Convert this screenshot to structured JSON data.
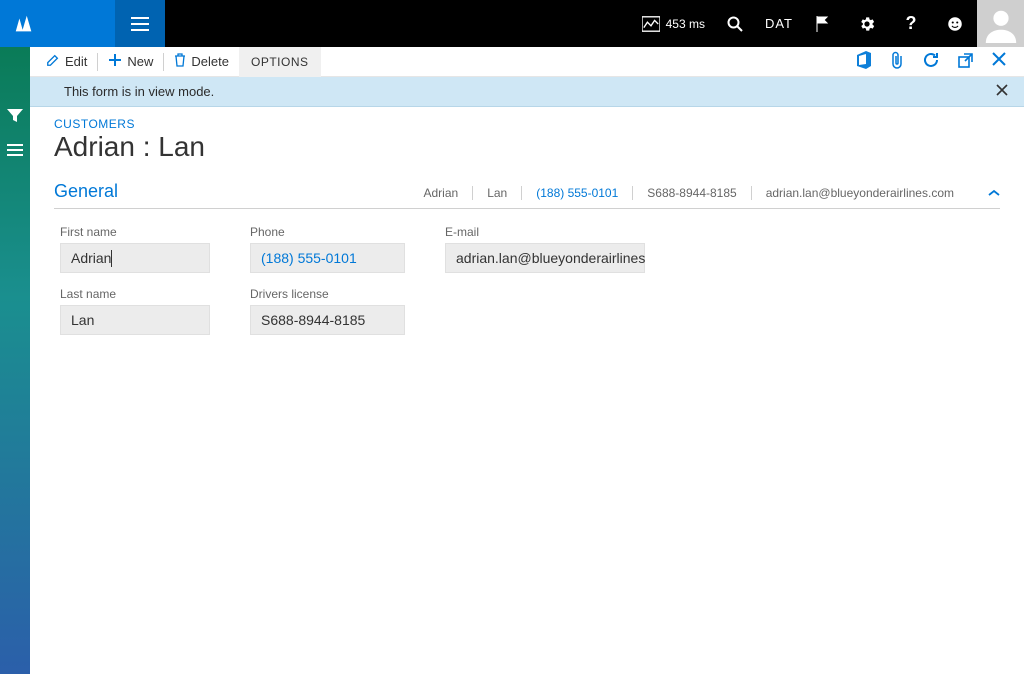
{
  "topbar": {
    "perf_label": "453 ms",
    "company": "DAT"
  },
  "actions": {
    "edit": "Edit",
    "new": "New",
    "delete": "Delete",
    "options": "OPTIONS"
  },
  "info": {
    "message": "This form is in view mode."
  },
  "page": {
    "breadcrumb": "CUSTOMERS",
    "title": "Adrian : Lan"
  },
  "section": {
    "title": "General",
    "summary": {
      "first": "Adrian",
      "last": "Lan",
      "phone": "(188) 555-0101",
      "license": "S688-8944-8185",
      "email": "adrian.lan@blueyonderairlines.com"
    }
  },
  "fields": {
    "first_name_label": "First name",
    "first_name_value": "Adrian",
    "last_name_label": "Last name",
    "last_name_value": "Lan",
    "phone_label": "Phone",
    "phone_value": "(188) 555-0101",
    "license_label": "Drivers license",
    "license_value": "S688-8944-8185",
    "email_label": "E-mail",
    "email_value": "adrian.lan@blueyonderairlines"
  }
}
